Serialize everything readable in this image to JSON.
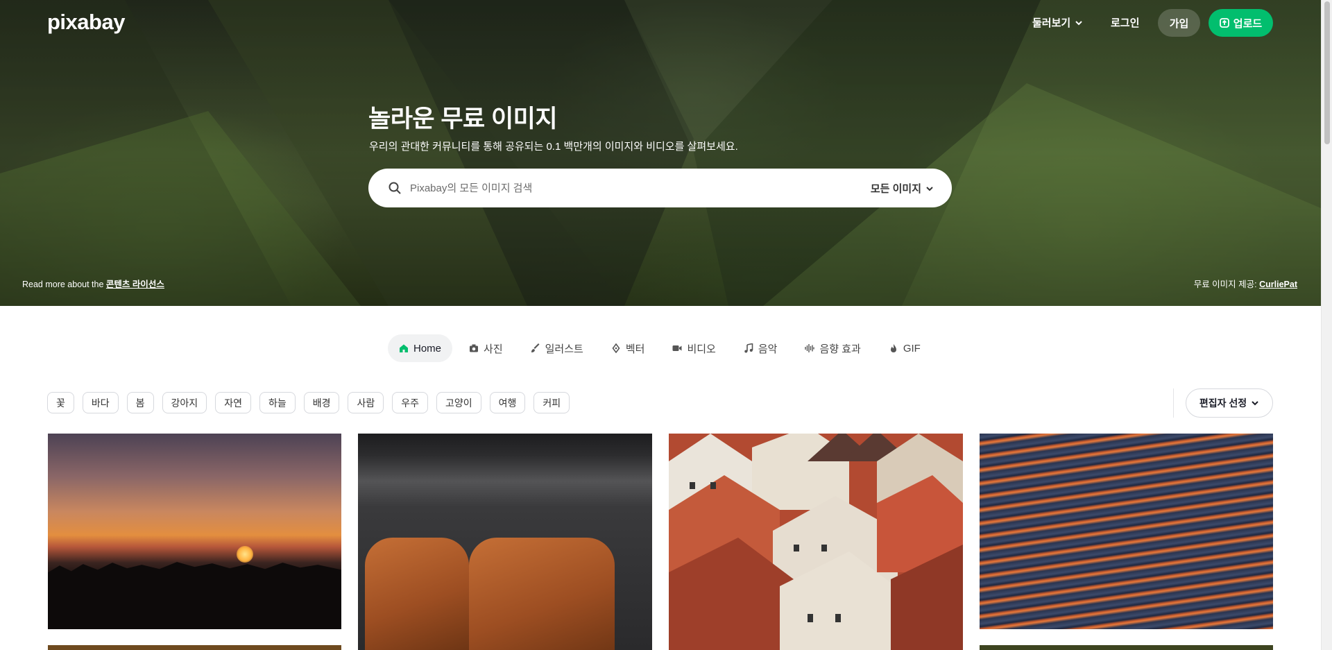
{
  "header": {
    "logo": "pixabay",
    "explore_label": "둘러보기",
    "login_label": "로그인",
    "join_label": "가입",
    "upload_label": "업로드"
  },
  "hero": {
    "title": "놀라운 무료 이미지",
    "subtitle": "우리의 관대한 커뮤니티를 통해 공유되는 0.1 백만개의 이미지와 비디오를 살펴보세요.",
    "search_placeholder": "Pixabay의 모든 이미지 검색",
    "search_filter": "모든 이미지",
    "license_prefix": "Read more about the ",
    "license_link": "콘텐츠 라이선스",
    "credit_prefix": "무료 이미지 제공: ",
    "credit_link": "CurliePat"
  },
  "tabs": [
    {
      "label": "Home",
      "icon": "home-icon",
      "active": true
    },
    {
      "label": "사진",
      "icon": "camera-icon"
    },
    {
      "label": "일러스트",
      "icon": "brush-icon"
    },
    {
      "label": "벡터",
      "icon": "pen-nib-icon"
    },
    {
      "label": "비디오",
      "icon": "video-icon"
    },
    {
      "label": "음악",
      "icon": "music-icon"
    },
    {
      "label": "음향 효과",
      "icon": "sound-wave-icon"
    },
    {
      "label": "GIF",
      "icon": "gif-icon"
    }
  ],
  "tags": [
    "꽃",
    "바다",
    "봄",
    "강아지",
    "자연",
    "하늘",
    "배경",
    "사람",
    "우주",
    "고양이",
    "여행",
    "커피"
  ],
  "editor_select_label": "편집자 선정",
  "colors": {
    "accent": "#02be6e",
    "text": "#191b26",
    "chip_border": "#d6d8dd"
  }
}
